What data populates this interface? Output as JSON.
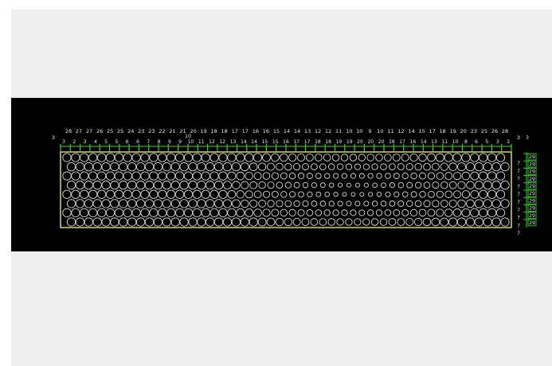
{
  "canvas": {
    "background": "#000000",
    "frame_color": "#efefef",
    "outline_color": "#e6e65a",
    "dimension_color": "#2fd62f",
    "hole_color": "#d9d9d9",
    "text_color": "#e8e8e8"
  },
  "top_row_labels": [
    "28",
    "27",
    "27",
    "26",
    "25",
    "25",
    "24",
    "23",
    "23",
    "22",
    "21",
    "21",
    "20",
    "19",
    "18",
    "18",
    "17",
    "17",
    "16",
    "16",
    "15",
    "14",
    "14",
    "13",
    "12",
    "12",
    "11",
    "10",
    "10",
    "9",
    "10",
    "11",
    "12",
    "14",
    "15",
    "17",
    "18",
    "19",
    "20",
    "23",
    "25",
    "26",
    "28"
  ],
  "second_row_labels": [
    "3",
    "2",
    "3",
    "4",
    "5",
    "5",
    "6",
    "6",
    "7",
    "8",
    "9",
    "9",
    "10",
    "11",
    "12",
    "12",
    "13",
    "14",
    "14",
    "15",
    "15",
    "16",
    "17",
    "17",
    "18",
    "18",
    "19",
    "19",
    "20",
    "20",
    "20",
    "18",
    "17",
    "16",
    "14",
    "13",
    "11",
    "10",
    "8",
    "6",
    "5",
    "3",
    "3"
  ],
  "left_marker": "3",
  "right_marker": "3",
  "upper_center_mark": "10",
  "right_dimension_labels": [
    "3",
    "7",
    "7",
    "7",
    "7",
    "7",
    "7",
    "7",
    "7",
    "7",
    "7"
  ],
  "right_box_labels": [
    "29",
    "29",
    "29",
    "29",
    "29",
    "29",
    "29",
    "29",
    "29",
    "29"
  ]
}
